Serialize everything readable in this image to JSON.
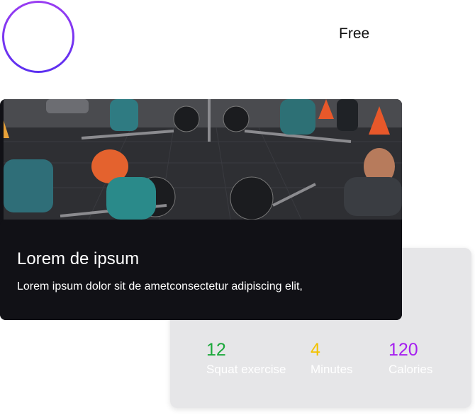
{
  "header": {
    "plan_label": "Free"
  },
  "feature_card": {
    "photo_subject": "rowing-class-photo",
    "title": "Lorem de ipsum",
    "description": "Lorem ipsum dolor sit de ametconsectetur adipiscing elit,"
  },
  "stats": [
    {
      "value": "12",
      "label": "Squat exercise",
      "color": "#1aa83a"
    },
    {
      "value": "4",
      "label": "Minutes",
      "color": "#f2c200"
    },
    {
      "value": "120",
      "label": "Calories",
      "color": "#a51ef0"
    }
  ],
  "colors": {
    "avatar_ring_top": "#9a3cf2",
    "avatar_ring_bottom": "#5b2ff0",
    "card_background": "#111116",
    "stats_background": "#e6e6e8"
  }
}
